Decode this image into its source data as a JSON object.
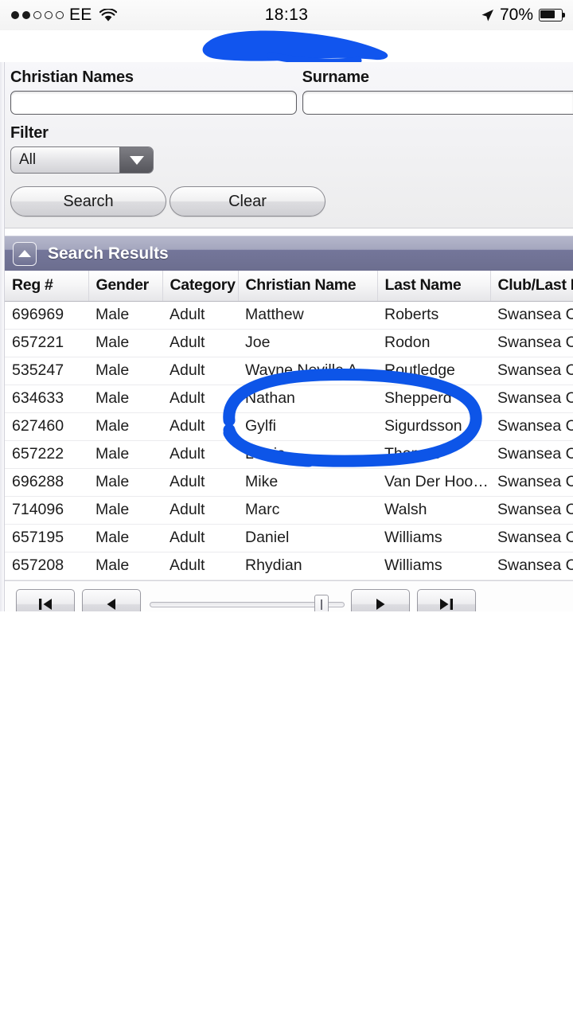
{
  "status_bar": {
    "signal_dots_total": 5,
    "signal_dots_filled": 2,
    "carrier": "EE",
    "wifi_icon": "wifi-icon",
    "time": "18:13",
    "location_icon": "location-arrow-icon",
    "battery_percent": "70%",
    "battery_level": 70
  },
  "annotations": {
    "redaction_color": "#1155ee",
    "circle_color": "#0d55e8",
    "circled_rows": [
      3,
      4,
      5
    ]
  },
  "search_form": {
    "christian_names": {
      "label": "Christian Names",
      "value": "",
      "placeholder": ""
    },
    "surname": {
      "label": "Surname",
      "value": "",
      "placeholder": ""
    },
    "filter": {
      "label": "Filter",
      "selected": "All",
      "options": [
        "All"
      ]
    },
    "search_button": "Search",
    "clear_button": "Clear"
  },
  "results_panel": {
    "title": "Search Results",
    "collapse_icon": "chevron-up-icon",
    "columns": [
      "Reg #",
      "Gender",
      "Category",
      "Christian Name",
      "Last Name",
      "Club/Last K"
    ],
    "rows": [
      {
        "reg": "696969",
        "gender": "Male",
        "category": "Adult",
        "first": "Matthew",
        "last": "Roberts",
        "club": "Swansea Ci"
      },
      {
        "reg": "657221",
        "gender": "Male",
        "category": "Adult",
        "first": "Joe",
        "last": "Rodon",
        "club": "Swansea Ci"
      },
      {
        "reg": "535247",
        "gender": "Male",
        "category": "Adult",
        "first": "Wayne Neville A…",
        "last": "Routledge",
        "club": "Swansea Ci"
      },
      {
        "reg": "634633",
        "gender": "Male",
        "category": "Adult",
        "first": "Nathan",
        "last": "Shepperd",
        "club": "Swansea Ci"
      },
      {
        "reg": "627460",
        "gender": "Male",
        "category": "Adult",
        "first": "Gylfi",
        "last": "Sigurdsson",
        "club": "Swansea Ci"
      },
      {
        "reg": "657222",
        "gender": "Male",
        "category": "Adult",
        "first": "Lewis",
        "last": "Thomas",
        "club": "Swansea Ci"
      },
      {
        "reg": "696288",
        "gender": "Male",
        "category": "Adult",
        "first": "Mike",
        "last": "Van Der Hoo…",
        "club": "Swansea Ci"
      },
      {
        "reg": "714096",
        "gender": "Male",
        "category": "Adult",
        "first": "Marc",
        "last": "Walsh",
        "club": "Swansea Ci"
      },
      {
        "reg": "657195",
        "gender": "Male",
        "category": "Adult",
        "first": "Daniel",
        "last": "Williams",
        "club": "Swansea Ci"
      },
      {
        "reg": "657208",
        "gender": "Male",
        "category": "Adult",
        "first": "Rhydian",
        "last": "Williams",
        "club": "Swansea Ci"
      }
    ]
  },
  "pager": {
    "first_icon": "skip-to-first-icon",
    "prev_icon": "previous-icon",
    "next_icon": "next-icon",
    "last_icon": "skip-to-last-icon",
    "slider_position_percent": 88
  }
}
